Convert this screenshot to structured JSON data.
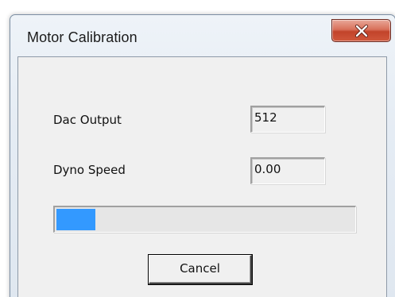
{
  "window": {
    "title": "Motor Calibration",
    "close_icon": "close-icon"
  },
  "fields": {
    "dac_output": {
      "label": "Dac Output",
      "value": "512"
    },
    "dyno_speed": {
      "label": "Dyno Speed",
      "value": "0.00"
    }
  },
  "progress": {
    "fraction": 0.13,
    "fill_color": "#3399ff"
  },
  "buttons": {
    "cancel_label": "Cancel"
  }
}
